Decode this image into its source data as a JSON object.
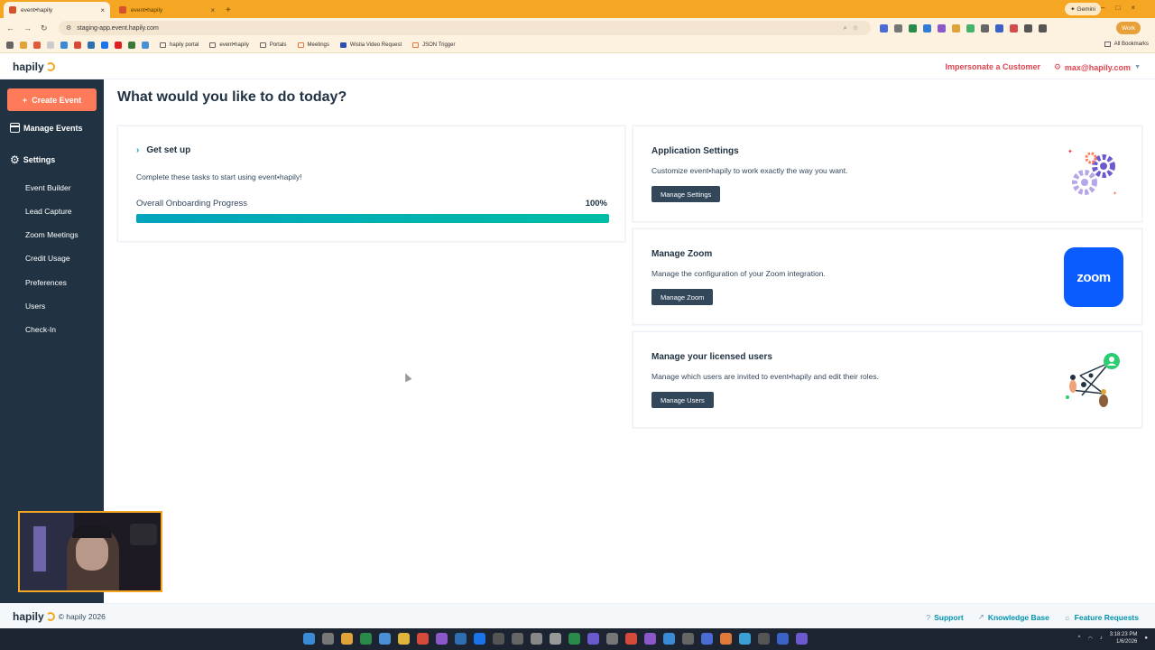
{
  "browser": {
    "tabs": [
      {
        "label": "event•hapily",
        "active": true
      },
      {
        "label": "event•hapily",
        "active": false
      }
    ],
    "gemini_label": "Gemini",
    "url": "staging-app.event.hapily.com",
    "profile_label": "Work",
    "bookmarks": [
      "hapily portal",
      "event•hapily",
      "Portals",
      "Meetings",
      "Wistia Video Request",
      "JSON Trigger"
    ],
    "all_bookmarks": "All Bookmarks"
  },
  "header": {
    "logo": "hapily",
    "impersonate": "Impersonate a Customer",
    "user_email": "max@hapily.com"
  },
  "sidebar": {
    "create_label": "Create Event",
    "manage_events": "Manage Events",
    "settings": "Settings",
    "items": [
      "Event Builder",
      "Lead Capture",
      "Zoom Meetings",
      "Credit Usage",
      "Preferences",
      "Users",
      "Check-In"
    ]
  },
  "main": {
    "title": "What would you like to do today?",
    "setup": {
      "heading": "Get set up",
      "description": "Complete these tasks to start using event•hapily!",
      "progress_label": "Overall Onboarding Progress",
      "progress_value": "100%",
      "progress_fraction": 1.0
    },
    "cards": [
      {
        "title": "Application Settings",
        "description": "Customize event•hapily to work exactly the way you want.",
        "button": "Manage Settings",
        "icon": "gears-icon"
      },
      {
        "title": "Manage Zoom",
        "description": "Manage the configuration of your Zoom integration.",
        "button": "Manage Zoom",
        "icon": "zoom-logo-icon",
        "logo_text": "zoom"
      },
      {
        "title": "Manage your licensed users",
        "description": "Manage which users are invited to event•hapily and edit their roles.",
        "button": "Manage Users",
        "icon": "users-network-icon"
      }
    ]
  },
  "footer": {
    "logo": "hapily",
    "copyright": "© hapily 2026",
    "links": [
      "Support",
      "Knowledge Base",
      "Feature Requests"
    ]
  },
  "taskbar": {
    "time": "3:18:23 PM",
    "date": "1/6/2026"
  },
  "colors": {
    "accent_orange": "#ff7a59",
    "sidebar_bg": "#213343",
    "progress_teal": "#00a4bd",
    "link_red": "#e0434f",
    "browser_orange": "#f5a623",
    "zoom_blue": "#0b5cff"
  }
}
